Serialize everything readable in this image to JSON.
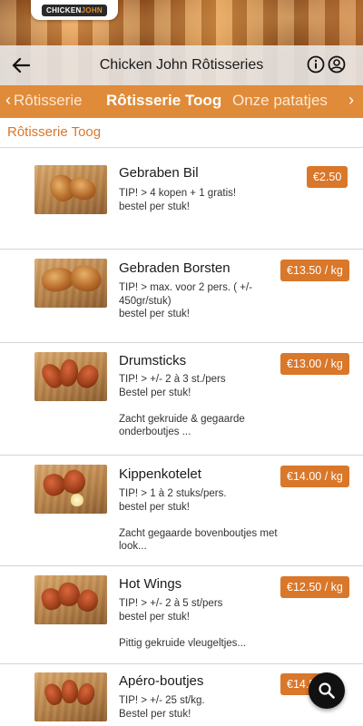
{
  "header": {
    "logo_text_left": "CHICKEN",
    "logo_text_right": "JOHN",
    "title": "Chicken John Rôtisseries",
    "back_icon": "arrow-left-icon",
    "info_icon": "info-icon",
    "user_icon": "user-icon"
  },
  "tabs": {
    "items": [
      {
        "label": "Rôtisserie"
      },
      {
        "label": "Rôtisserie Toog",
        "active": true
      },
      {
        "label": "Onze patatjes"
      }
    ],
    "prev_label": "‹",
    "next_label": "›"
  },
  "section": {
    "title": "Rôtisserie Toog"
  },
  "colors": {
    "accent": "#d9772a",
    "tab_bar": "#e08b39"
  },
  "products": [
    {
      "name": "Gebraben Bil",
      "desc": "TIP! > 4 kopen + 1 gratis!\nbestel per stuk!",
      "price": "€2.50"
    },
    {
      "name": "Gebraden Borsten",
      "desc": "TIP! > max. voor 2 pers. ( +/- 450gr/stuk)\nbestel per stuk!",
      "price": "€13.50 / kg"
    },
    {
      "name": "Drumsticks",
      "desc": "TIP! > +/- 2 à 3 st./pers\nBestel per stuk!\n\nZacht gekruide & gegaarde onderboutjes ...",
      "price": "€13.00 / kg"
    },
    {
      "name": "Kippenkotelet",
      "desc": "TIP! > 1 à 2 stuks/pers.\nbestel per stuk!\n\nZacht gegaarde bovenboutjes met look...",
      "price": "€14.00 / kg"
    },
    {
      "name": "Hot Wings",
      "desc": "TIP! > +/- 2 à 5 st/pers\nbestel per stuk!\n\nPittig gekruide vleugeltjes...",
      "price": "€12.50 / kg"
    },
    {
      "name": "Apéro-boutjes",
      "desc": "TIP! > +/- 25 st/kg.\nBestel per stuk!",
      "price": "€14.50"
    }
  ],
  "fab": {
    "icon": "search-icon"
  }
}
